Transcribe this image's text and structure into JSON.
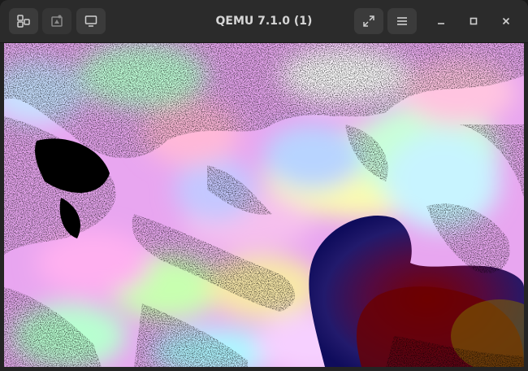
{
  "window": {
    "title": "QEMU 7.1.0 (1)"
  },
  "toolbar": {
    "left_buttons": [
      {
        "icon": "view-switch-icon"
      },
      {
        "icon": "screenshot-icon"
      },
      {
        "icon": "display-icon"
      }
    ],
    "right_buttons": [
      {
        "icon": "fullscreen-icon"
      },
      {
        "icon": "menu-icon"
      }
    ],
    "window_controls": [
      {
        "icon": "minimize-icon"
      },
      {
        "icon": "maximize-icon"
      },
      {
        "icon": "close-icon"
      }
    ]
  },
  "colors": {
    "titlebar_bg": "#2b2b2b",
    "button_bg": "#3b3b3b",
    "title_text": "#d6d6d6",
    "icon": "#d0d0d0"
  }
}
